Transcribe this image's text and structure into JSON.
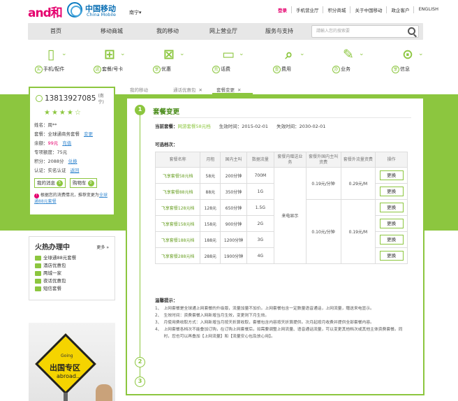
{
  "header": {
    "logo_and": "and和",
    "logo_cm": "中国移动",
    "logo_cm_en": "China Mobile",
    "city": "南宁▾",
    "links": [
      "登录",
      "手机营业厅",
      "积分商城",
      "关于中国移动",
      "政企客户",
      "ENGLISH"
    ]
  },
  "nav": {
    "items": [
      "首页",
      "移动商城",
      "我的移动",
      "网上营业厅",
      "服务与支持"
    ],
    "search_placeholder": "請輸入您的搜索要"
  },
  "icon_row": [
    {
      "mark": "买",
      "label": "手机/配件",
      "icon": "phone-icon"
    },
    {
      "mark": "选",
      "label": "套餐/号卡",
      "icon": "basket-icon"
    },
    {
      "mark": "享",
      "label": "优惠",
      "icon": "gift-icon"
    },
    {
      "mark": "充",
      "label": "话费",
      "icon": "card-icon"
    },
    {
      "mark": "查",
      "label": "费用",
      "icon": "search-icon"
    },
    {
      "mark": "办",
      "label": "业务",
      "icon": "pen-icon"
    },
    {
      "mark": "享",
      "label": "信息",
      "icon": "location-icon"
    }
  ],
  "user": {
    "phone": "13813927085",
    "city": "(南宁)",
    "stars": "★★★★",
    "star_empty": "☆",
    "name_label": "姓名：",
    "name": "周**",
    "plan_label": "套餐：",
    "plan": "全球通商务套餐",
    "plan_link": "变更",
    "balance_label": "余额：",
    "balance": "99元",
    "balance_link": "充值",
    "exclusive_label": "专项额度：",
    "exclusive": "75元",
    "points_label": "积分：",
    "points": "2088分",
    "points_link": "兑换",
    "auth_label": "认证：",
    "auth": "实名认证",
    "auth_link": "返回",
    "msg_btn": "我的消息",
    "msg_count": "5",
    "cart_btn": "购物车",
    "cart_count": "0",
    "note": "根据您的消费情况，推荐变更为",
    "note_link": "全球通88元套餐"
  },
  "hot": {
    "title": "火热办理中",
    "more": "更多 »",
    "items": [
      "全球通88元套餐",
      "酒店优惠包",
      "两城一家",
      "夜话优惠包",
      "短信套餐"
    ]
  },
  "promo": {
    "going": "Going",
    "title": "出国专区",
    "subtitle": "abroad..."
  },
  "tabs": [
    {
      "label": "我的移动",
      "close": ""
    },
    {
      "label": "通话优惠包",
      "close": "✕"
    },
    {
      "label": "套餐变更",
      "close": "✕"
    }
  ],
  "panel": {
    "steps": [
      "1",
      "2",
      "3"
    ],
    "title": "套餐变更",
    "current_label": "当前套餐：",
    "current_plan": "网游套餐58元档",
    "effective_label": "生效时间：",
    "effective": "2015-02-01",
    "expire_label": "失效时间：",
    "expire": "2030-02-01",
    "available_label": "可选档次："
  },
  "table": {
    "headers": [
      "套餐名称",
      "月租",
      "国内主叫",
      "数据流量",
      "套餐内赠送业务",
      "套餐外国内主叫资费",
      "套餐外流量资费",
      "操作"
    ],
    "rows": [
      {
        "name": "飞享套餐58元档",
        "fee": "58元",
        "call": "200分钟",
        "data": "700M"
      },
      {
        "name": "飞享套餐88元档",
        "fee": "88元",
        "call": "350分钟",
        "data": "1G"
      },
      {
        "name": "飞享套餐128元档",
        "fee": "128元",
        "call": "650分钟",
        "data": "1.5G"
      },
      {
        "name": "飞享套餐158元档",
        "fee": "158元",
        "call": "900分钟",
        "data": "2G"
      },
      {
        "name": "飞享套餐188元档",
        "fee": "188元",
        "call": "1200分钟",
        "data": "3G"
      },
      {
        "name": "飞享套餐288元档",
        "fee": "288元",
        "call": "1900分钟",
        "data": "4G"
      }
    ],
    "gift": "来电显示",
    "call_rate_a": "0.19元/分钟",
    "data_rate_a": "0.29元/M",
    "call_rate_b": "0.10元/分钟",
    "data_rate_b": "0.19元/M",
    "action": "更换"
  },
  "notes": {
    "title": "温馨提示：",
    "items": [
      "上网套餐是全球通上网套餐的升级版，流量加量不加价。上网套餐包含一定数量语音通话，上网流量，赠送来电显示。",
      "生效时间：资费套餐入网新增当月生效，变更则下月生效。",
      "月使用费收取方式：入网新增当月按天折算收取，套餐包含内容按天折算提供。次月起按月收费并提供全部套餐内容。",
      "上网套餐各档次不能叠加订购，在订购上网套餐后，如需要调整上网流量、语音通话流量，可以变更其他档次或其他主体资费套餐。同时，您也可以再叠加【上网流量】和【流量安心包及放心用】。"
    ]
  }
}
